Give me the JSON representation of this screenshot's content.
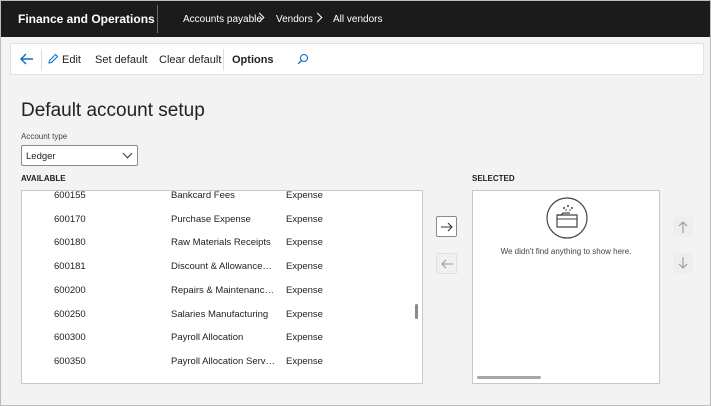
{
  "app": {
    "title": "Finance and Operations"
  },
  "breadcrumbs": [
    "Accounts payable",
    "Vendors",
    "All vendors"
  ],
  "actions": {
    "edit": "Edit",
    "set_default": "Set default",
    "clear_default": "Clear default",
    "options": "Options"
  },
  "page": {
    "title": "Default account setup"
  },
  "account_type": {
    "label": "Account type",
    "value": "Ledger"
  },
  "available": {
    "label": "AVAILABLE",
    "rows": [
      {
        "code": "600155",
        "name": "Bankcard Fees",
        "type": "Expense"
      },
      {
        "code": "600170",
        "name": "Purchase Expense",
        "type": "Expense"
      },
      {
        "code": "600180",
        "name": "Raw Materials Receipts",
        "type": "Expense"
      },
      {
        "code": "600181",
        "name": "Discount & Allowance…",
        "type": "Expense"
      },
      {
        "code": "600200",
        "name": "Repairs & Maintenanc…",
        "type": "Expense"
      },
      {
        "code": "600250",
        "name": "Salaries Manufacturing",
        "type": "Expense"
      },
      {
        "code": "600300",
        "name": "Payroll Allocation",
        "type": "Expense"
      },
      {
        "code": "600350",
        "name": "Payroll Allocation Serv…",
        "type": "Expense"
      }
    ]
  },
  "selected": {
    "label": "SELECTED",
    "empty_message": "We didn't find anything to show here."
  },
  "colors": {
    "topbar": "#1b1b1b",
    "accent": "#0f6cbd"
  },
  "icons": [
    "back-arrow-icon",
    "pencil-icon",
    "search-icon",
    "arrow-right-icon",
    "arrow-left-icon",
    "arrow-up-icon",
    "arrow-down-icon",
    "empty-folder-icon"
  ]
}
